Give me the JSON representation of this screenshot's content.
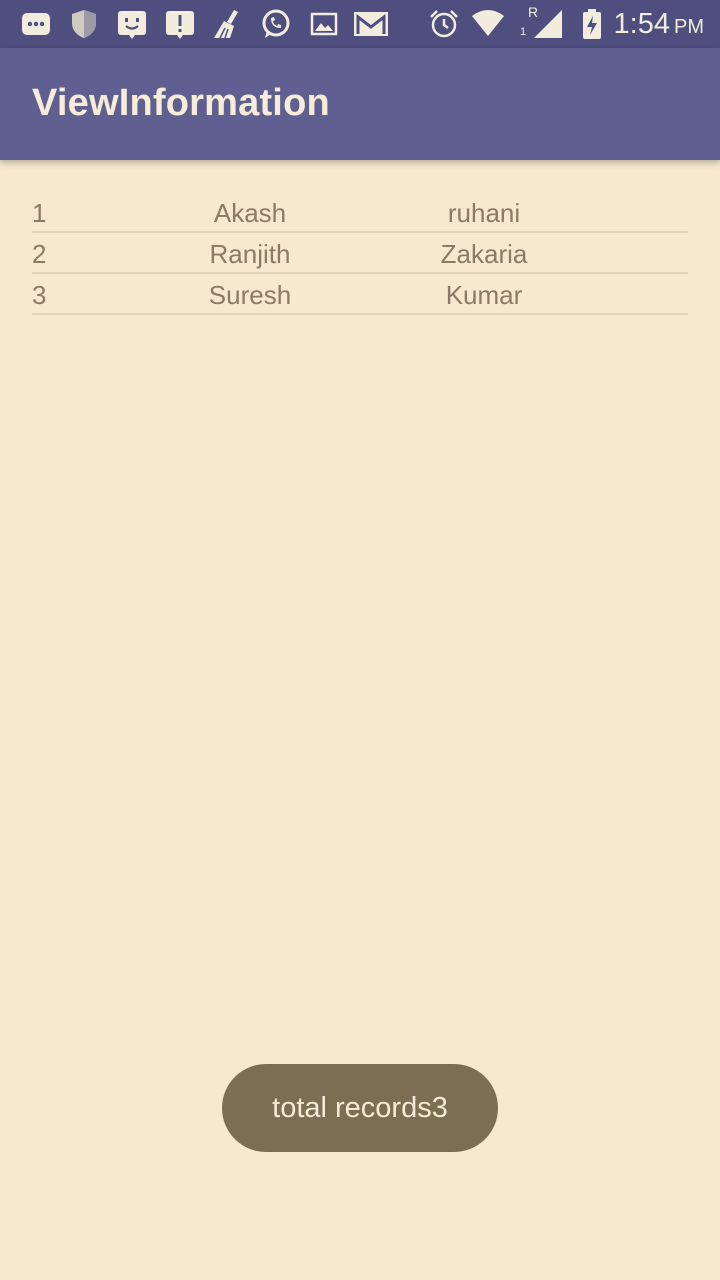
{
  "status_bar": {
    "time": "1:54",
    "ampm": "PM",
    "network_label": "R",
    "sim_label": "1",
    "icons": [
      "more-notifications-icon",
      "shield-icon",
      "chat-face-icon",
      "alert-icon",
      "cleaner-broom-icon",
      "whatsapp-icon",
      "image-icon",
      "gmail-icon",
      "alarm-icon",
      "wifi-icon",
      "cell-signal-icon",
      "battery-charging-icon"
    ]
  },
  "app_bar": {
    "title": "ViewInformation"
  },
  "records": [
    {
      "id": "1",
      "first": "Akash",
      "last": "ruhani"
    },
    {
      "id": "2",
      "first": "Ranjith",
      "last": "Zakaria"
    },
    {
      "id": "3",
      "first": "Suresh",
      "last": "Kumar"
    }
  ],
  "toast": {
    "text": "total records3"
  },
  "colors": {
    "status_bar": "#4e4f7f",
    "app_bar": "#5f6091",
    "background": "#f7e9d0",
    "row_text": "#8a7a67",
    "toast": "#7b6e53"
  }
}
